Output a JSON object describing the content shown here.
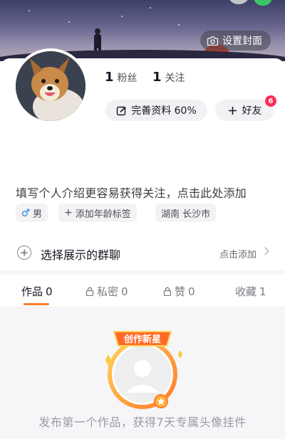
{
  "header": {
    "set_cover_label": "设置封面",
    "camera_icon": "camera-icon"
  },
  "profile": {
    "stats": [
      {
        "value": "1",
        "label": "粉丝"
      },
      {
        "value": "1",
        "label": "关注"
      }
    ],
    "complete_profile_label": "完善资料 60%",
    "friends_label": "好友",
    "friends_badge": "6",
    "bio_placeholder": "填写个人介绍更容易获得关注，点击此处添加",
    "tags": {
      "gender": "男",
      "add_age": "添加年龄标签",
      "location": "湖南 长沙市"
    }
  },
  "group_chat": {
    "title": "选择展示的群聊",
    "action": "点击添加"
  },
  "tabs": [
    {
      "label": "作品",
      "count": "0"
    },
    {
      "label": "私密",
      "count": "0"
    },
    {
      "label": "赞",
      "count": "0"
    },
    {
      "label": "收藏",
      "count": "1"
    }
  ],
  "empty_state": {
    "emblem_text": "创作新星",
    "message": "发布第一个作品，获得7天专属头像挂件"
  },
  "colors": {
    "accent": "#fe7a2b",
    "badge": "#fe2c55"
  }
}
